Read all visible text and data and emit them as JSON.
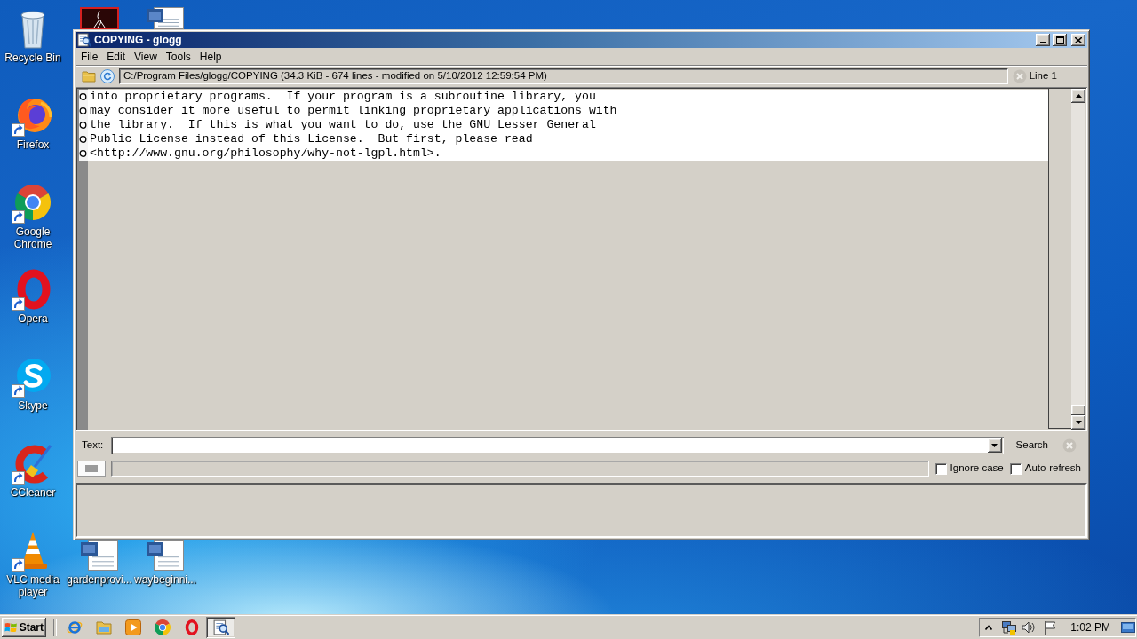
{
  "desktop": {
    "icons": [
      {
        "label": "Recycle Bin",
        "kind": "recycle-bin",
        "shortcut": false
      },
      {
        "label": "Firefox",
        "kind": "firefox",
        "shortcut": true
      },
      {
        "label": "Google Chrome",
        "kind": "chrome",
        "shortcut": true
      },
      {
        "label": "Opera",
        "kind": "opera",
        "shortcut": true
      },
      {
        "label": "Skype",
        "kind": "skype",
        "shortcut": true
      },
      {
        "label": "CCleaner",
        "kind": "ccleaner",
        "shortcut": true
      },
      {
        "label": "VLC media player",
        "kind": "vlc",
        "shortcut": true
      }
    ],
    "partly_hidden_icons": [
      {
        "kind": "app"
      },
      {
        "kind": "document"
      }
    ],
    "files": [
      {
        "label": "gardenprovi...",
        "kind": "document"
      },
      {
        "label": "waybeginni...",
        "kind": "document"
      }
    ]
  },
  "window": {
    "title": "COPYING - glogg",
    "menu": [
      "File",
      "Edit",
      "View",
      "Tools",
      "Help"
    ],
    "toolbar": {
      "path": "C:/Program Files/glogg/COPYING (34.3 KiB - 674 lines - modified on 5/10/2012 12:59:54 PM)",
      "line_indicator": "Line 1"
    },
    "lines": [
      "into proprietary programs.  If your program is a subroutine library, you",
      "may consider it more useful to permit linking proprietary applications with",
      "the library.  If this is what you want to do, use the GNU Lesser General",
      "Public License instead of this License.  But first, please read",
      "<http://www.gnu.org/philosophy/why-not-lgpl.html>."
    ],
    "search": {
      "label": "Text:",
      "button": "Search",
      "options": [
        {
          "label": "Ignore case",
          "checked": false
        },
        {
          "label": "Auto-refresh",
          "checked": false
        }
      ]
    }
  },
  "taskbar": {
    "start": "Start",
    "apps": [
      {
        "kind": "ie",
        "selected": false
      },
      {
        "kind": "explorer",
        "selected": false
      },
      {
        "kind": "media-player",
        "selected": false
      },
      {
        "kind": "chrome",
        "selected": false
      },
      {
        "kind": "opera",
        "selected": false
      },
      {
        "kind": "glogg",
        "selected": true
      }
    ],
    "clock": "1:02 PM"
  }
}
